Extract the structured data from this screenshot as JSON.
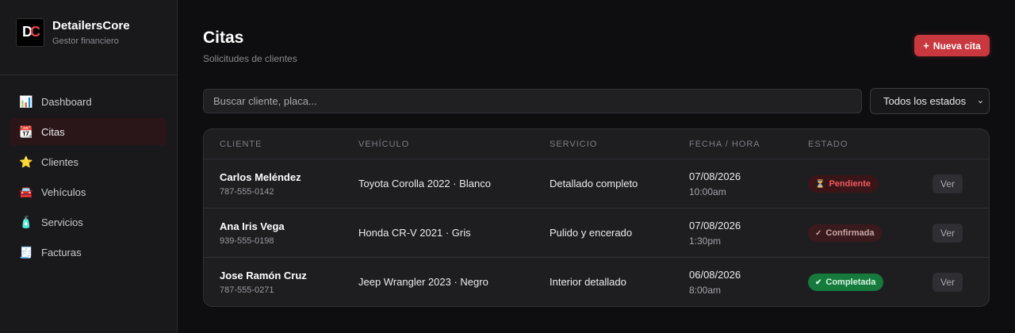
{
  "brand": {
    "logo_d": "D",
    "logo_c": "C",
    "name": "DetailersCore",
    "subtitle": "Gestor financiero"
  },
  "sidebar": {
    "items": [
      {
        "label": "Dashboard",
        "icon": "📊",
        "icon_name": "chart-icon",
        "active": false
      },
      {
        "label": "Citas",
        "icon": "📆",
        "icon_name": "calendar-icon",
        "active": true
      },
      {
        "label": "Clientes",
        "icon": "⭐",
        "icon_name": "star-icon",
        "active": false
      },
      {
        "label": "Vehículos",
        "icon": "🚘",
        "icon_name": "car-icon",
        "active": false
      },
      {
        "label": "Servicios",
        "icon": "🧴",
        "icon_name": "lotion-bottle-icon",
        "active": false
      },
      {
        "label": "Facturas",
        "icon": "🧾",
        "icon_name": "receipt-icon",
        "active": false
      }
    ]
  },
  "header": {
    "title": "Citas",
    "subtitle": "Solicitudes de clientes",
    "new_button_icon": "+",
    "new_button_label": "Nueva cita"
  },
  "filters": {
    "search_placeholder": "Buscar cliente, placa...",
    "status_selected": "Todos los estados",
    "status_chevron": "⌄"
  },
  "table": {
    "columns": [
      "CLIENTE",
      "VEHÍCULO",
      "SERVICIO",
      "FECHA / HORA",
      "ESTADO"
    ],
    "rows": [
      {
        "name": "Carlos Meléndez",
        "phone": "787-555-0142",
        "vehicle": "Toyota Corolla 2022 · Blanco",
        "service": "Detallado completo",
        "date": "07/08/2026",
        "time": "10:00am",
        "status_icon": "⏳",
        "status": "Pendiente",
        "action": "Ver"
      },
      {
        "name": "Ana Iris Vega",
        "phone": "939-555-0198",
        "vehicle": "Honda CR-V 2021 · Gris",
        "service": "Pulido y encerado",
        "date": "07/08/2026",
        "time": "1:30pm",
        "status_icon": "✓",
        "status": "Confirmada",
        "action": "Ver"
      },
      {
        "name": "Jose Ramón Cruz",
        "phone": "787-555-0271",
        "vehicle": "Jeep Wrangler 2023 · Negro",
        "service": "Interior detallado",
        "date": "06/08/2026",
        "time": "8:00am",
        "status_icon": "✔",
        "status": "Completada",
        "action": "Ver"
      }
    ]
  },
  "colors": {
    "accent": "#c9383e",
    "pending": "#ef5a5f",
    "completed": "#167a3d"
  }
}
